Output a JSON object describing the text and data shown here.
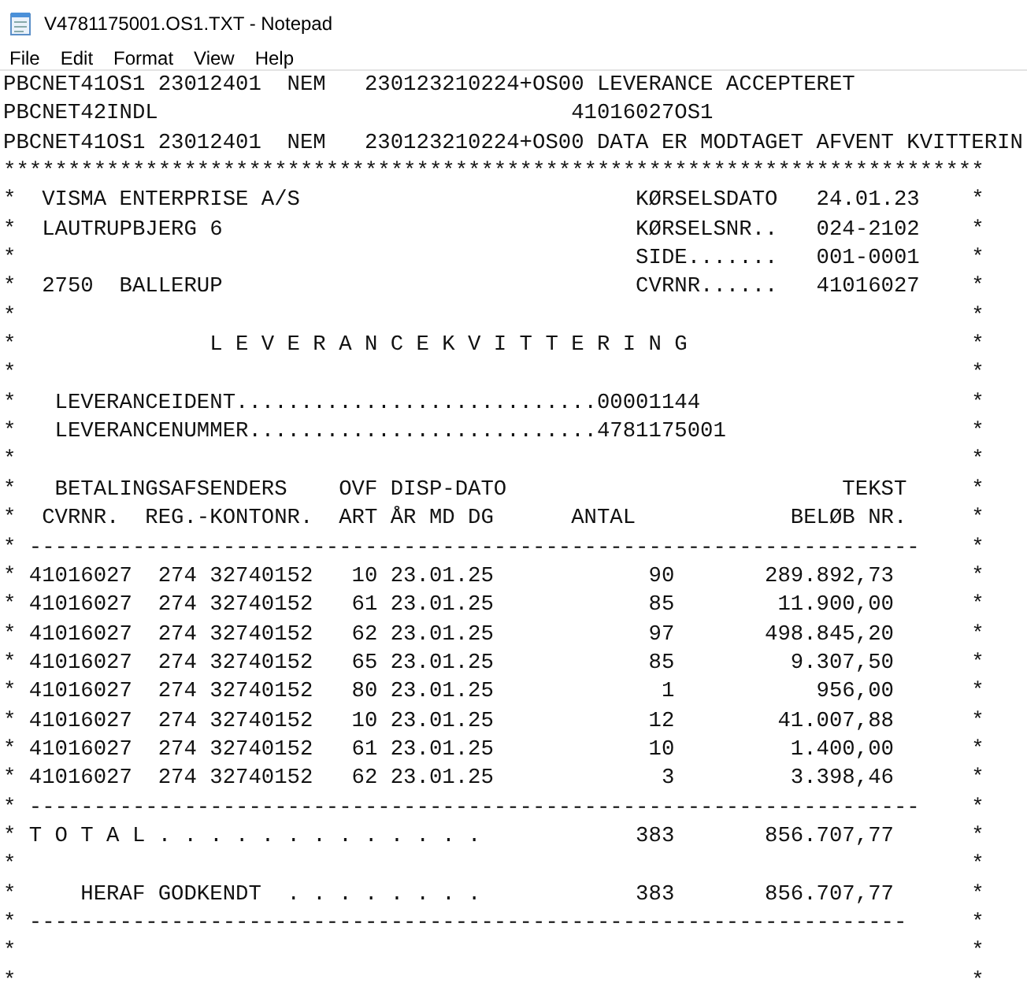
{
  "window": {
    "title": "V4781175001.OS1.TXT - Notepad"
  },
  "menu": [
    "File",
    "Edit",
    "Format",
    "View",
    "Help"
  ],
  "editor": {
    "lines": [
      "PBCNET41OS1 23012401  NEM   230123210224+OS00 LEVERANCE ACCEPTERET",
      "PBCNET42INDL                                41016027OS1",
      "PBCNET41OS1 23012401  NEM   230123210224+OS00 DATA ER MODTAGET AFVENT KVITTERIN",
      "****************************************************************************",
      "*  VISMA ENTERPRISE A/S                          KØRSELSDATO   24.01.23    *",
      "*  LAUTRUPBJERG 6                                KØRSELSNR..   024-2102    *",
      "*                                                SIDE.......   001-0001    *",
      "*  2750  BALLERUP                                CVRNR......   41016027    *",
      "*                                                                          *",
      "*               L E V E R A N C E K V I T T E R I N G                      *",
      "*                                                                          *",
      "*   LEVERANCEIDENT............................00001144                     *",
      "*   LEVERANCENUMMER...........................4781175001                   *",
      "*                                                                          *",
      "*   BETALINGSAFSENDERS    OVF DISP-DATO                          TEKST     *",
      "*  CVRNR.  REG.-KONTONR.  ART ÅR MD DG      ANTAL            BELØB NR.     *",
      "* ---------------------------------------------------------------------    *",
      "* 41016027  274 32740152   10 23.01.25            90       289.892,73      *",
      "* 41016027  274 32740152   61 23.01.25            85        11.900,00      *",
      "* 41016027  274 32740152   62 23.01.25            97       498.845,20      *",
      "* 41016027  274 32740152   65 23.01.25            85         9.307,50      *",
      "* 41016027  274 32740152   80 23.01.25             1           956,00      *",
      "* 41016027  274 32740152   10 23.01.25            12        41.007,88      *",
      "* 41016027  274 32740152   61 23.01.25            10         1.400,00      *",
      "* 41016027  274 32740152   62 23.01.25             3         3.398,46      *",
      "* ---------------------------------------------------------------------    *",
      "* T O T A L . . . . . . . . . . . . .            383       856.707,77      *",
      "*                                                                          *",
      "*     HERAF GODKENDT  . . . . . . . .            383       856.707,77      *",
      "* --------------------------------------------------------------------     *",
      "*                                                                          *",
      "*                                                                          *"
    ]
  }
}
